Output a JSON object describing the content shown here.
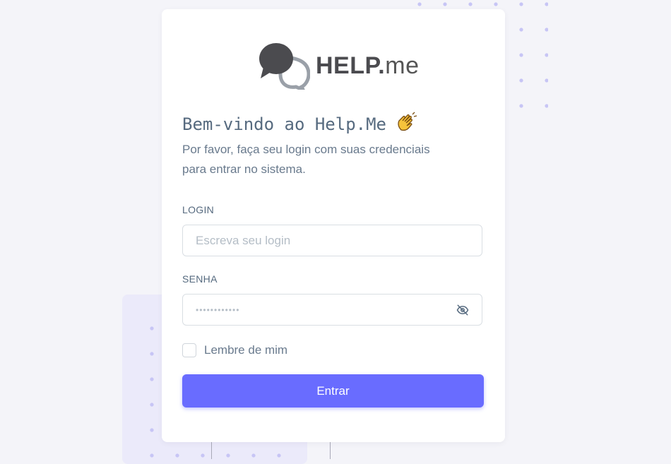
{
  "brand": {
    "logo_bold": "HELP.",
    "logo_light": "me"
  },
  "welcome": {
    "title": "Bem-vindo ao Help.Me"
  },
  "subtitle": {
    "line1": "Por favor, faça seu login com suas credenciais",
    "line2": "para entrar no sistema."
  },
  "login": {
    "label": "LOGIN",
    "placeholder": "Escreva seu login"
  },
  "password": {
    "label": "SENHA",
    "placeholder": "••••••••••••"
  },
  "remember": {
    "label": "Lembre de mim"
  },
  "submit": {
    "label": "Entrar"
  },
  "colors": {
    "accent": "#696cff",
    "background": "#f4f4f9",
    "text": "#566a7f"
  },
  "icons": {
    "logo": "speech-bubbles-icon",
    "wave": "waving-hand-icon",
    "eye": "eye-off-icon"
  }
}
